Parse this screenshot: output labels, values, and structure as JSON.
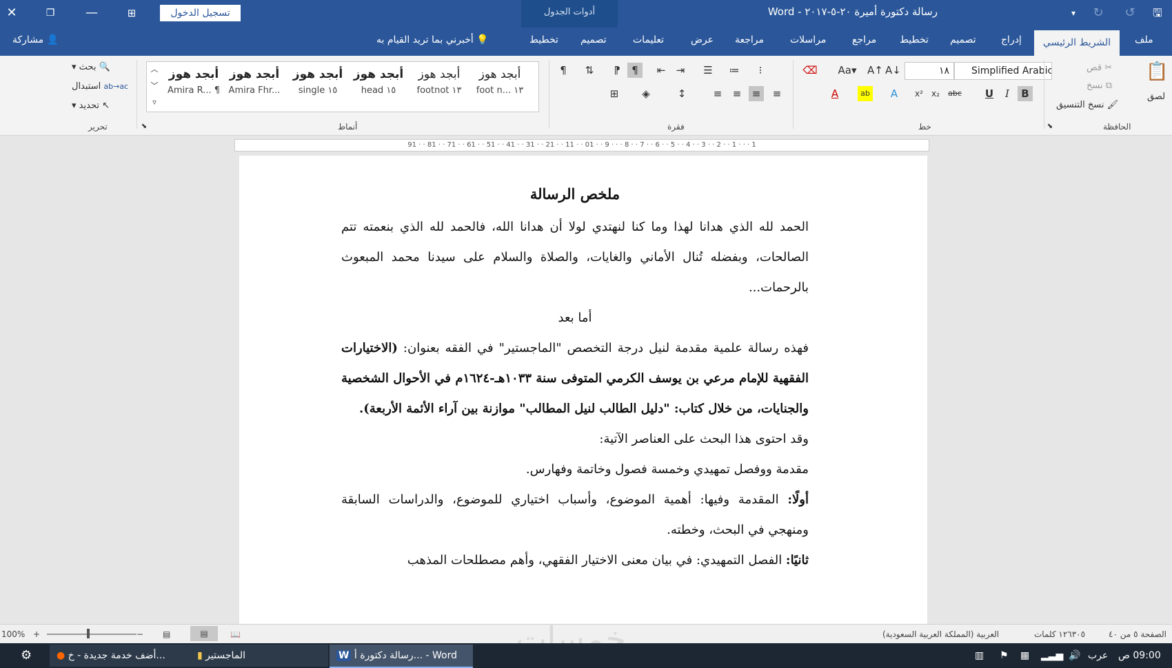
{
  "titlebar": {
    "title": "رسالة دكتورة أميرة ٢٠-٥-٢٠١٧ - Word",
    "context_tools": "أدوات الجدول",
    "signin_label": "تسجيل الدخول"
  },
  "tabs": {
    "file": "ملف",
    "home": "الشريط الرئيسي",
    "insert": "إدراج",
    "design": "تصميم",
    "layout": "تخطيط",
    "references": "مراجع",
    "mailings": "مراسلات",
    "review": "مراجعة",
    "view": "عرض",
    "help": "تعليمات",
    "table_design": "تصميم",
    "table_layout": "تخطيط",
    "tell_me": "أخبرني بما تريد القيام به",
    "share": "مشاركة"
  },
  "ribbon": {
    "clipboard": {
      "group_label": "الحافظة",
      "paste": "لصق",
      "cut": "قص",
      "copy": "نسخ",
      "format_painter": "نسخ التنسيق"
    },
    "font": {
      "group_label": "خط",
      "font_name": "Simplified Arabic",
      "font_size": "١٨"
    },
    "paragraph": {
      "group_label": "فقرة"
    },
    "styles": {
      "group_label": "أنماط",
      "items": [
        {
          "sample": "أبجد هوز",
          "name": "foot n... ١٣"
        },
        {
          "sample": "أبجد هوز",
          "name": "footnot ١٣"
        },
        {
          "sample": "أبجد هوز",
          "name": "head ١٥"
        },
        {
          "sample": "أبجد هوز",
          "name": "single ١٥"
        },
        {
          "sample": "أبجد هوز",
          "name": "Amira Fhr..."
        },
        {
          "sample": "أبجد هوز",
          "name": "Amira R... ¶"
        }
      ]
    },
    "editing": {
      "group_label": "تحرير",
      "find": "بحث",
      "replace": "استبدال",
      "select": "تحديد"
    }
  },
  "ruler": {
    "ticks": "91 · · 81 · · 71 · · 61 · · 51 · · 41 · · 31 · · 21 · · 11 · · 01 · · 9 · · · 8 · · 7 · · 6 · · 5 · · 4 · · 3 · · 2 · · 1 · · · 1"
  },
  "document": {
    "heading": "ملخص الرسالة",
    "p1": "الحمد لله الذي هدانا لهذا وما كنا لنهتدي لولا أن هدانا الله، فالحمد لله الذي بنعمته تتم الصالحات، وبفضله تُنال الأماني والغايات، والصلاة والسلام على سيدنا محمد المبعوث بالرحمات...",
    "amma_baad": "أما بعد",
    "p2": "فهذه رسالة علمية مقدمة لنيل درجة التخصص \"الماجستير\" في الفقه بعنوان:",
    "p2_bold": "(الاختيارات الفقهية للإمام مرعي بن يوسف الكرمي المتوفى سنة ١٠٣٣هـ-١٦٢٤م في الأحوال الشخصية والجنايات، من خلال كتاب: \"دليل الطالب لنيل المطالب\" موازنة بين آراء الأئمة الأربعة).",
    "p3": "وقد احتوى هذا البحث على العناصر الآتية:",
    "p4": "مقدمة ووفصل تمهيدي وخمسة فصول وخاتمة وفهارس.",
    "p5_label": "أولًا:",
    "p5": " المقدمة وفيها: أهمية الموضوع، وأسباب اختياري للموضوع، والدراسات السابقة ومنهجي في البحث، وخطته.",
    "p6_label": "ثانيًا:",
    "p6": " الفصل التمهيدي: في بيان معنى الاختيار الفقهي، وأهم مصطلحات المذهب"
  },
  "statusbar": {
    "page": "الصفحة ٥ من ٤٠",
    "words": "١٢٦٣٠٥ كلمات",
    "language": "العربية (المملكة العربية السعودية)",
    "zoom": "100%"
  },
  "taskbar": {
    "word_task": "رسالة دكتورة أ... - Word",
    "folder_task": "الماجستير",
    "firefox_task": "أضف خدمة جديدة - خ...",
    "lang": "عرب",
    "time": "09:00 ص"
  },
  "watermark": "خمسات"
}
